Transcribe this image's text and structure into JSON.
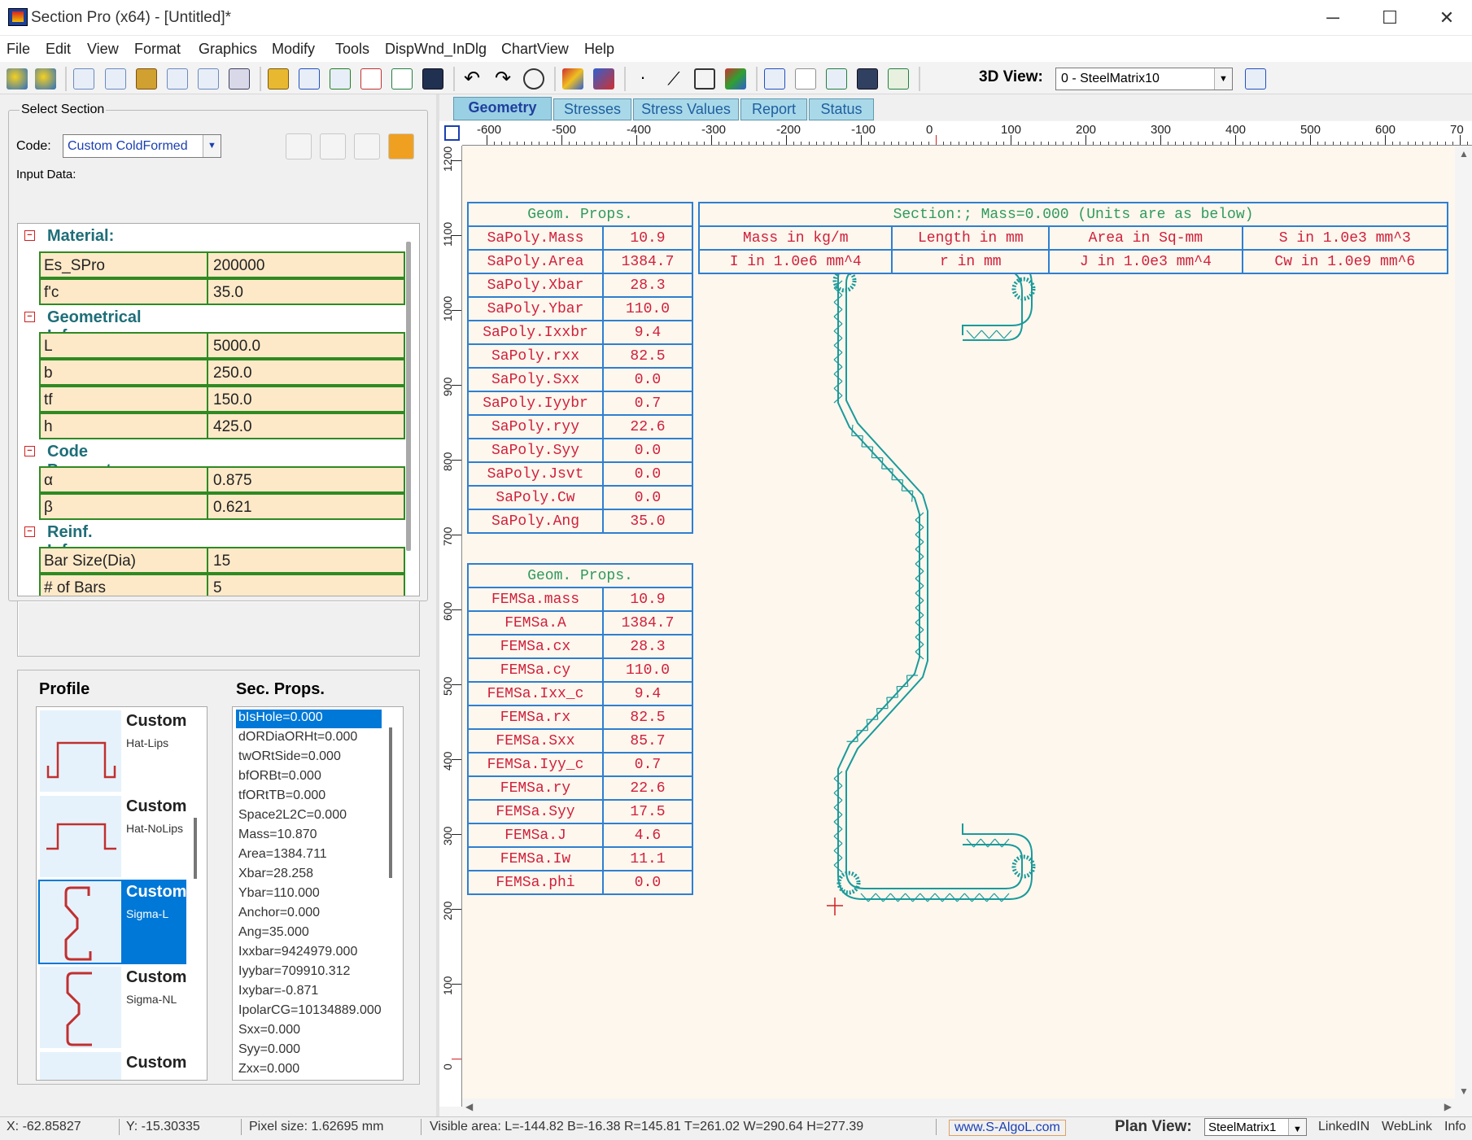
{
  "window": {
    "title": "Section Pro (x64) - [Untitled]*",
    "minimize": "─",
    "maximize": "☐",
    "close": "✕"
  },
  "menu": [
    "File",
    "Edit",
    "View",
    "Format",
    "Graphics",
    "Modify",
    "Tools",
    "DispWnd_InDlg",
    "ChartView",
    "Help"
  ],
  "toolbar": {
    "view3d_label": "3D View:",
    "view3d_value": "0 - SteelMatrix10"
  },
  "left": {
    "select_section": "Select Section",
    "code_label": "Code:",
    "code_value": "Custom ColdFormed",
    "input_data": "Input Data:",
    "sections": [
      {
        "title": "Material:",
        "rows": [
          {
            "k": "Es_SPro",
            "v": "200000"
          },
          {
            "k": "f'c",
            "v": "35.0"
          }
        ]
      },
      {
        "title": "Geometrical Info:",
        "rows": [
          {
            "k": "L",
            "v": "5000.0"
          },
          {
            "k": "b",
            "v": "250.0"
          },
          {
            "k": "tf",
            "v": "150.0"
          },
          {
            "k": "h",
            "v": "425.0"
          }
        ]
      },
      {
        "title": "Code Parameters:",
        "rows": [
          {
            "k": "α",
            "v": "0.875"
          },
          {
            "k": "β",
            "v": "0.621"
          }
        ]
      },
      {
        "title": "Reinf. Info:",
        "rows": [
          {
            "k": "Bar Size(Dia)",
            "v": "15"
          },
          {
            "k": "# of Bars",
            "v": "5"
          }
        ]
      }
    ],
    "profile_label": "Profile",
    "secprops_label": "Sec. Props.",
    "profiles": [
      {
        "name": "Custom",
        "sub": "Hat-Lips"
      },
      {
        "name": "Custom",
        "sub": "Hat-NoLips"
      },
      {
        "name": "Custom",
        "sub": "Sigma-L"
      },
      {
        "name": "Custom",
        "sub": "Sigma-NL"
      },
      {
        "name": "Custom",
        "sub": ""
      }
    ],
    "secprops": [
      "bIsHole=0.000",
      "dORDiaORHt=0.000",
      "twORtSide=0.000",
      "bfORBt=0.000",
      "tfORtTB=0.000",
      "Space2L2C=0.000",
      "Mass=10.870",
      "Area=1384.711",
      "Xbar=28.258",
      "Ybar=110.000",
      "Anchor=0.000",
      "Ang=35.000",
      "Ixxbar=9424979.000",
      "Iyybar=709910.312",
      "Ixybar=-0.871",
      "IpolarCG=10134889.000",
      "Sxx=0.000",
      "Syy=0.000",
      "Zxx=0.000"
    ]
  },
  "tabs": [
    "Geometry",
    "Stresses",
    "Stress Values",
    "Report",
    "Status"
  ],
  "ruler_h": [
    "-600",
    "-500",
    "-400",
    "-300",
    "-200",
    "-100",
    "0",
    "100",
    "200",
    "300",
    "400",
    "500",
    "600",
    "70"
  ],
  "ruler_v": [
    "1200",
    "1100",
    "1000",
    "900",
    "800",
    "700",
    "600",
    "500",
    "400",
    "300",
    "200",
    "100",
    "0"
  ],
  "geom1": {
    "header": "Geom. Props.",
    "rows": [
      [
        "SaPoly.Mass",
        "10.9"
      ],
      [
        "SaPoly.Area",
        "1384.7"
      ],
      [
        "SaPoly.Xbar",
        "28.3"
      ],
      [
        "SaPoly.Ybar",
        "110.0"
      ],
      [
        "SaPoly.Ixxbr",
        "9.4"
      ],
      [
        "SaPoly.rxx",
        "82.5"
      ],
      [
        "SaPoly.Sxx",
        "0.0"
      ],
      [
        "SaPoly.Iyybr",
        "0.7"
      ],
      [
        "SaPoly.ryy",
        "22.6"
      ],
      [
        "SaPoly.Syy",
        "0.0"
      ],
      [
        "SaPoly.Jsvt",
        "0.0"
      ],
      [
        "SaPoly.Cw",
        "0.0"
      ],
      [
        "SaPoly.Ang",
        "35.0"
      ]
    ]
  },
  "geom2": {
    "header": "Geom. Props.",
    "rows": [
      [
        "FEMSa.mass",
        "10.9"
      ],
      [
        "FEMSa.A",
        "1384.7"
      ],
      [
        "FEMSa.cx",
        "28.3"
      ],
      [
        "FEMSa.cy",
        "110.0"
      ],
      [
        "FEMSa.Ixx_c",
        "9.4"
      ],
      [
        "FEMSa.rx",
        "82.5"
      ],
      [
        "FEMSa.Sxx",
        "85.7"
      ],
      [
        "FEMSa.Iyy_c",
        "0.7"
      ],
      [
        "FEMSa.ry",
        "22.6"
      ],
      [
        "FEMSa.Syy",
        "17.5"
      ],
      [
        "FEMSa.J",
        "4.6"
      ],
      [
        "FEMSa.Iw",
        "11.1"
      ],
      [
        "FEMSa.phi",
        "0.0"
      ]
    ]
  },
  "units": {
    "header": "Section:; Mass=0.000 (Units are as below)",
    "row1": [
      "Mass in kg/m",
      "Length in mm",
      "Area in Sq-mm",
      "S in 1.0e3 mm^3"
    ],
    "row2": [
      "I in 1.0e6 mm^4",
      "r in mm",
      "J in 1.0e3 mm^4",
      "Cw in 1.0e9 mm^6"
    ]
  },
  "status": {
    "x": "X: -62.85827",
    "y": "Y: -15.30335",
    "pixel": "Pixel size: 1.62695 mm",
    "visible": "Visible area:  L=-144.82  B=-16.38  R=145.81  T=261.02   W=290.64  H=277.39",
    "web": "www.S-AlgoL.com",
    "plan_label": "Plan View:",
    "plan_value": "SteelMatrix1",
    "linkedin": "LinkedIN",
    "weblink": "WebLink",
    "info": "Info"
  },
  "colors": {
    "mesh": "#1a9a9a",
    "table_border": "#2f7fd0",
    "table_text": "#d0203a",
    "header_text": "#2f9a5a",
    "selection": "#0078d7"
  }
}
